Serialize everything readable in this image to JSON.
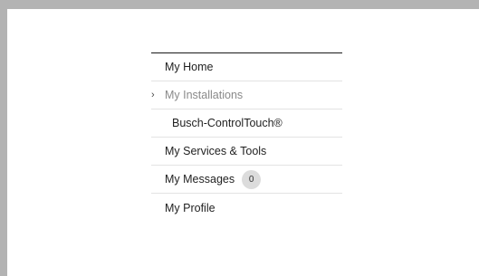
{
  "nav": {
    "items": [
      {
        "label": "My Home"
      },
      {
        "label": "My Installations",
        "caret": "›"
      },
      {
        "label": "Busch-ControlTouch®"
      },
      {
        "label": "My Services & Tools"
      },
      {
        "label": "My Messages",
        "badge": "0"
      },
      {
        "label": "My Profile"
      }
    ]
  },
  "colors": {
    "background_frame": "#b3b3b3",
    "panel": "#ffffff",
    "text": "#1f1f1f",
    "active_text": "#8a8a8a",
    "badge_bg": "#dcdcdc"
  }
}
